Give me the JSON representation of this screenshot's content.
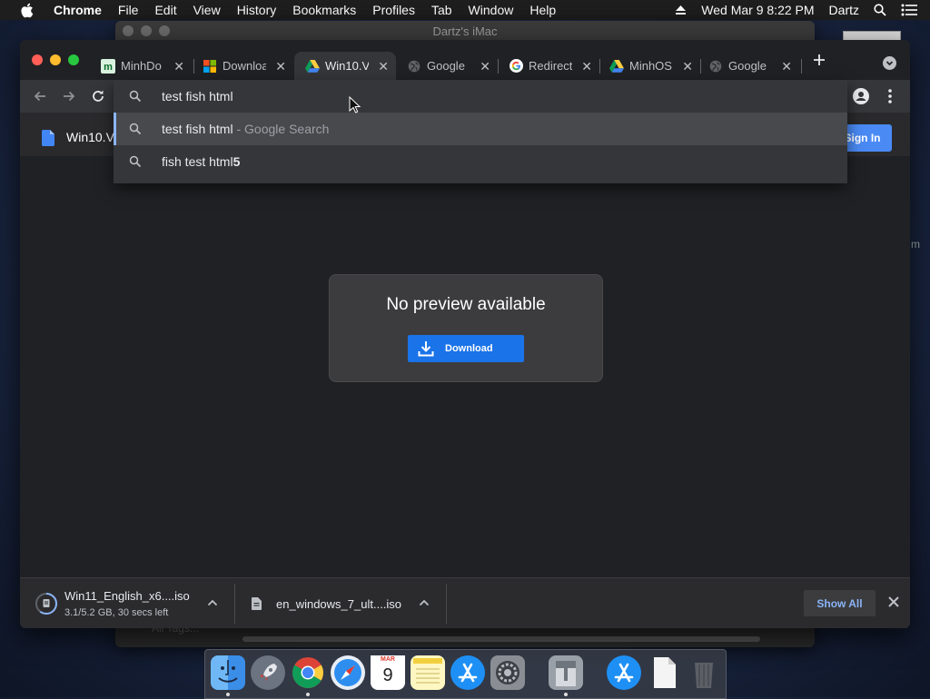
{
  "menubar": {
    "app": "Chrome",
    "items": [
      "File",
      "Edit",
      "View",
      "History",
      "Bookmarks",
      "Profiles",
      "Tab",
      "Window",
      "Help"
    ],
    "clock": "Wed Mar 9  8:22 PM",
    "user": "Dartz"
  },
  "remote_window": {
    "title": "Dartz's iMac",
    "footer_text": "All Tags..."
  },
  "side_text": "m",
  "tabs": [
    {
      "label": "MinhDo",
      "icon": "minhdo-favicon"
    },
    {
      "label": "Downloa",
      "icon": "microsoft-logo-icon"
    },
    {
      "label": "Win10.V",
      "icon": "google-drive-icon",
      "active": true
    },
    {
      "label": "Google",
      "icon": "globe-icon"
    },
    {
      "label": "Redirect",
      "icon": "google-g-icon"
    },
    {
      "label": "MinhOS",
      "icon": "google-drive-icon"
    },
    {
      "label": "Google",
      "icon": "globe-icon"
    }
  ],
  "omnibox": {
    "query": "test fish html",
    "suggestions": [
      {
        "text": "test fish html",
        "suffix": "- Google Search"
      },
      {
        "text_plain": "fish test html",
        "text_bold": "5"
      }
    ]
  },
  "document": {
    "title": "Win10.V",
    "signin_label": "Sign In"
  },
  "preview": {
    "title": "No preview available",
    "download_label": "Download"
  },
  "downloads": [
    {
      "name": "Win11_English_x6....iso",
      "status": "3.1/5.2 GB, 30 secs left",
      "progress": 0.6
    },
    {
      "name": "en_windows_7_ult....iso"
    }
  ],
  "shelf": {
    "show_all_label": "Show All"
  },
  "dock": {
    "calendar_month": "MAR",
    "calendar_day": "9",
    "apps": [
      "finder",
      "launchpad",
      "chrome",
      "safari",
      "calendar",
      "notes",
      "app-store",
      "system-preferences",
      "archive-utility",
      "app-store-2",
      "document",
      "trash"
    ]
  },
  "colors": {
    "accent": "#1a73e8",
    "signin": "#4a8af4",
    "link": "#8ab4f8"
  }
}
